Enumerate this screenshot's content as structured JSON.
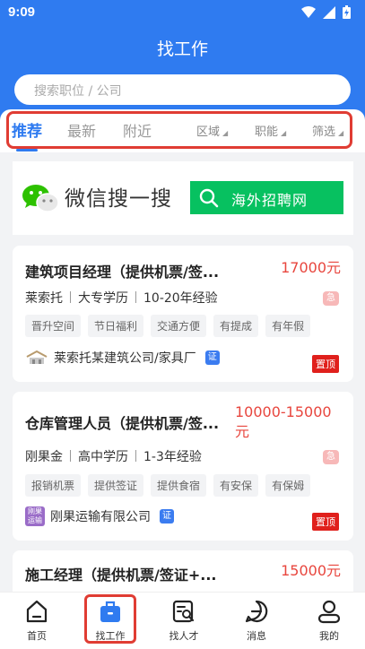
{
  "status_bar": {
    "time": "9:09"
  },
  "header": {
    "title": "找工作"
  },
  "search": {
    "placeholder": "搜索职位 / 公司"
  },
  "tabs": [
    {
      "label": "推荐",
      "active": true
    },
    {
      "label": "最新",
      "active": false
    },
    {
      "label": "附近",
      "active": false
    }
  ],
  "filters": [
    {
      "label": "区域"
    },
    {
      "label": "职能"
    },
    {
      "label": "筛选"
    }
  ],
  "banner": {
    "text": "微信搜一搜",
    "search_label": "海外招聘网",
    "accent": "#07c160"
  },
  "jobs": [
    {
      "title": "建筑项目经理（提供机票/签...",
      "salary": "17000元",
      "location": "莱索托",
      "education": "大专学历",
      "experience": "10-20年经验",
      "urgent": "急",
      "tags": [
        "晋升空间",
        "节日福利",
        "交通方便",
        "有提成",
        "有年假"
      ],
      "company": "莱索托某建筑公司/家具厂",
      "cert": "证",
      "badge": "置顶"
    },
    {
      "title": "仓库管理人员（提供机票/签...",
      "salary": "10000-15000元",
      "location": "刚果金",
      "education": "高中学历",
      "experience": "1-3年经验",
      "urgent": "急",
      "tags": [
        "报销机票",
        "提供签证",
        "提供食宿",
        "有安保",
        "有保姆"
      ],
      "company": "刚果运输有限公司",
      "company_logo_text": "刚果运输",
      "cert": "证",
      "badge": "置顶"
    },
    {
      "title": "施工经理（提供机票/签证+...",
      "salary": "15000元"
    }
  ],
  "bottom_nav": [
    {
      "label": "首页",
      "icon": "home-icon",
      "active": false
    },
    {
      "label": "找工作",
      "icon": "briefcase-icon",
      "active": true
    },
    {
      "label": "找人才",
      "icon": "talent-search-icon",
      "active": false
    },
    {
      "label": "消息",
      "icon": "message-icon",
      "active": false
    },
    {
      "label": "我的",
      "icon": "profile-icon",
      "active": false
    }
  ],
  "colors": {
    "primary": "#2f7bf0",
    "salary": "#e8463e",
    "highlight": "#e03c33"
  }
}
